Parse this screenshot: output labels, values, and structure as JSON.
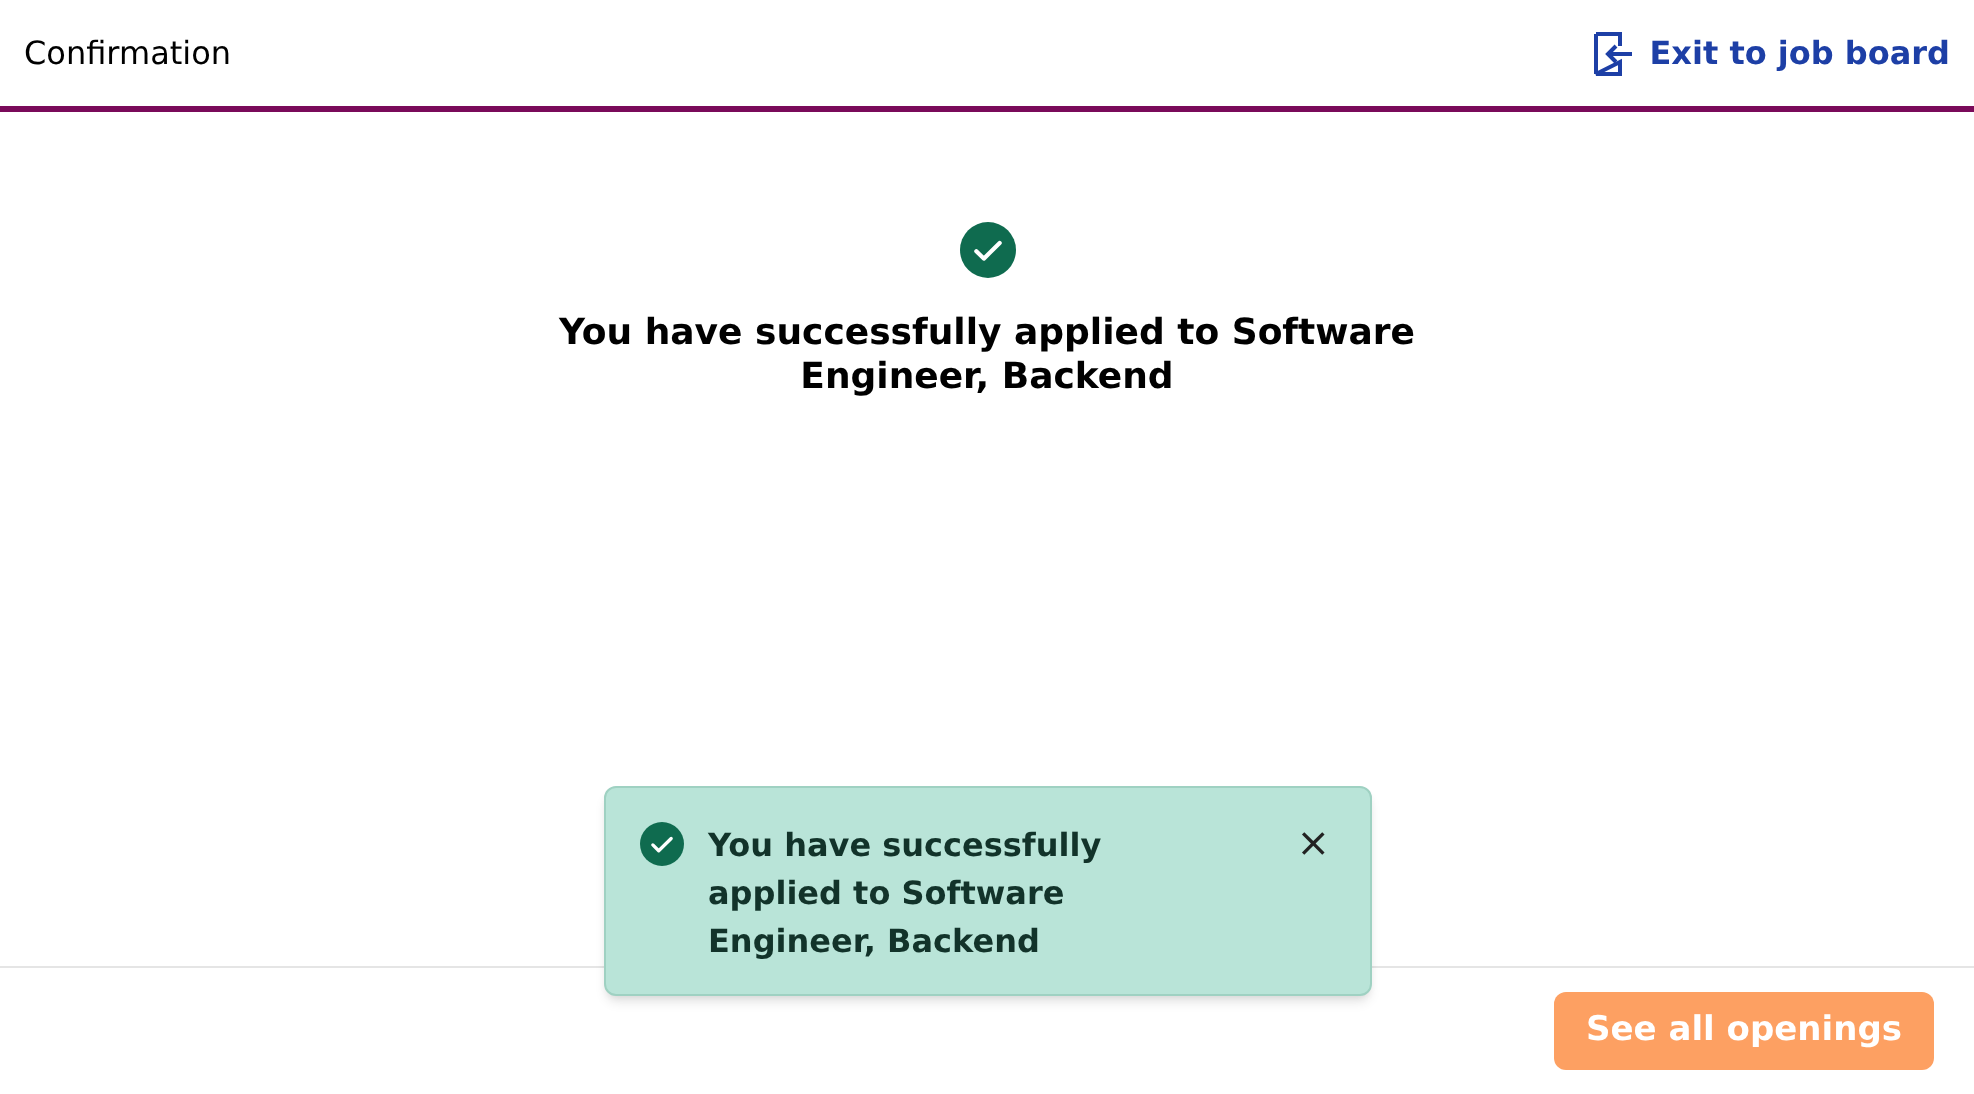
{
  "header": {
    "title": "Confirmation",
    "exit_link": "Exit to job board"
  },
  "confirmation": {
    "message": "You have successfully applied to Software Engineer, Backend"
  },
  "toast": {
    "message": "You have successfully applied to Software Engineer, Backend",
    "close": "×"
  },
  "footer": {
    "button": "See all openings"
  }
}
